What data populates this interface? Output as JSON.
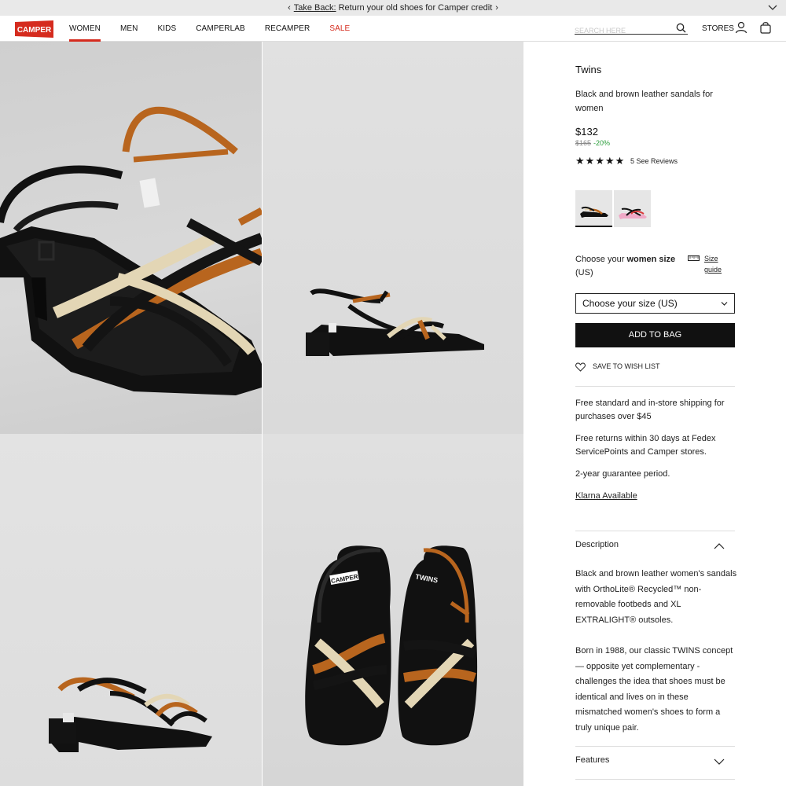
{
  "promo": {
    "link": "Take Back:",
    "text": " Return your old shoes for Camper credit"
  },
  "header": {
    "logo": "CAMPER",
    "nav": [
      "WOMEN",
      "MEN",
      "KIDS",
      "CAMPERLAB",
      "RECAMPER",
      "SALE"
    ],
    "search_placeholder": "SEARCH HERE",
    "stores": "STORES"
  },
  "product": {
    "name": "Twins",
    "description": "Black and brown leather sandals for women",
    "price": "$132",
    "old_price": "$165",
    "discount": "-20%",
    "rating": 5,
    "reviews": "5 See Reviews",
    "size_label_prefix": "Choose your ",
    "size_label_bold": "women size",
    "size_label_suffix": " (US)",
    "size_guide": "Size guide",
    "size_select": "Choose your size (US)",
    "add_to_bag": "ADD TO BAG",
    "wish_list": "SAVE TO WISH LIST",
    "shipping": "Free standard and in-store shipping for purchases over $45",
    "returns": "Free returns within 30 days at Fedex ServicePoints and Camper stores.",
    "guarantee": "2-year guarantee period.",
    "klarna": "Klarna Available",
    "description_title": "Description",
    "description_p1": "Black and brown leather women's sandals with OrthoLite® Recycled™ non-removable footbeds and XL EXTRALIGHT® outsoles.",
    "description_p2": "Born in 1988, our classic TWINS concept — opposite yet complementary - challenges the idea that shoes must be identical and lives on in these mismatched women's shoes to form a truly unique pair.",
    "features_title": "Features"
  },
  "colors": {
    "brand_red": "#d52b1e",
    "sale_red": "#d52b1e",
    "discount_green": "#2a9d3a",
    "button_black": "#111111"
  },
  "images": {
    "insole_text_left": "CAMPER",
    "insole_text_right": "TWINS"
  }
}
